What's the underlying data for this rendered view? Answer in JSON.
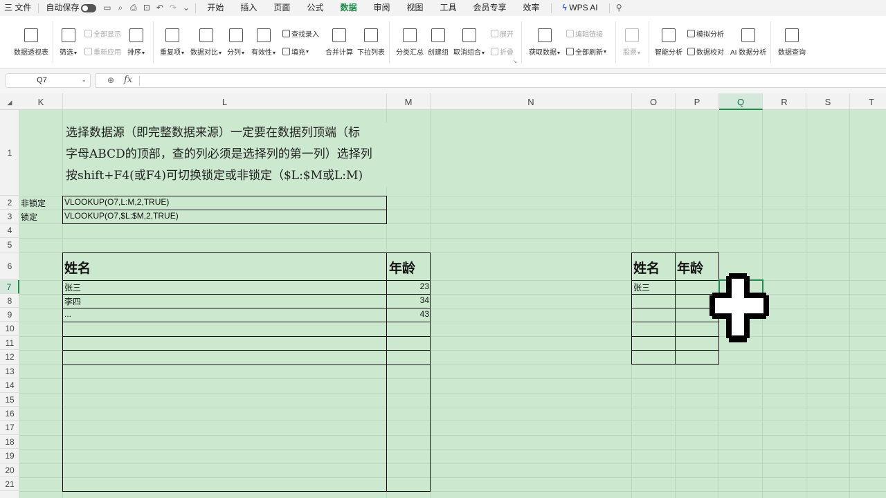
{
  "menubar": {
    "menu_icon": "三",
    "file": "文件",
    "autosave": "自动保存",
    "tabs": [
      "开始",
      "插入",
      "页面",
      "公式",
      "数据",
      "审阅",
      "视图",
      "工具",
      "会员专享",
      "效率"
    ],
    "active_tab": "数据",
    "wps_ai": "WPS AI",
    "accent_color": "#1f8a4c"
  },
  "ribbon": {
    "pivot": "数据透视表",
    "filter": "筛选",
    "show_all": "全部显示",
    "reapply": "重新应用",
    "sort": "排序",
    "duplicates": "重复项",
    "compare": "数据对比",
    "split": "分列",
    "validity": "有效性",
    "find_entry": "查找录入",
    "fill": "填充",
    "consolidate": "合并计算",
    "dropdown": "下拉列表",
    "subtotal": "分类汇总",
    "group": "创建组",
    "ungroup": "取消组合",
    "expand": "展开",
    "collapse": "折叠",
    "get_data": "获取数据",
    "edit_links": "编辑链接",
    "refresh_all": "全部刷新",
    "stocks": "股票",
    "smart_analysis": "智能分析",
    "what_if": "模拟分析",
    "data_check": "数据校对",
    "ai_analysis": "AI 数据分析",
    "data_query": "数据查询"
  },
  "formula_bar": {
    "name_box": "Q7",
    "fx_label": "fx",
    "formula": ""
  },
  "sheet": {
    "columns": [
      "K",
      "L",
      "M",
      "N",
      "O",
      "P",
      "Q",
      "R",
      "S",
      "T"
    ],
    "selected_column": "Q",
    "rows": [
      "1",
      "2",
      "3",
      "4",
      "5",
      "6",
      "7",
      "8",
      "9",
      "10",
      "11",
      "12",
      "13",
      "14",
      "15",
      "16",
      "17",
      "18",
      "19",
      "20",
      "21"
    ],
    "selected_row": "7",
    "note_lines": [
      "选择数据源（即完整数据来源）一定要在数据列顶端（标",
      "字母ABCD的顶部，查的列必须是选择列的第一列）选择列",
      "按shift+F4(或F4)可切换锁定或非锁定（$L:$M或L:M)"
    ],
    "label_unlocked": "非锁定",
    "formula_unlocked": "VLOOKUP(O7,L:M,2,TRUE)",
    "label_locked": "锁定",
    "formula_locked": "VLOOKUP(O7,$L:$M,2,TRUE)",
    "source_table": {
      "headers": [
        "姓名",
        "年龄"
      ],
      "rows": [
        [
          "张三",
          "23"
        ],
        [
          "李四",
          "34"
        ],
        [
          "...",
          "43"
        ]
      ]
    },
    "lookup_table": {
      "headers": [
        "姓名",
        "年龄"
      ],
      "rows": [
        [
          "张三",
          ""
        ]
      ]
    },
    "grid_color": "#cce8cf"
  }
}
